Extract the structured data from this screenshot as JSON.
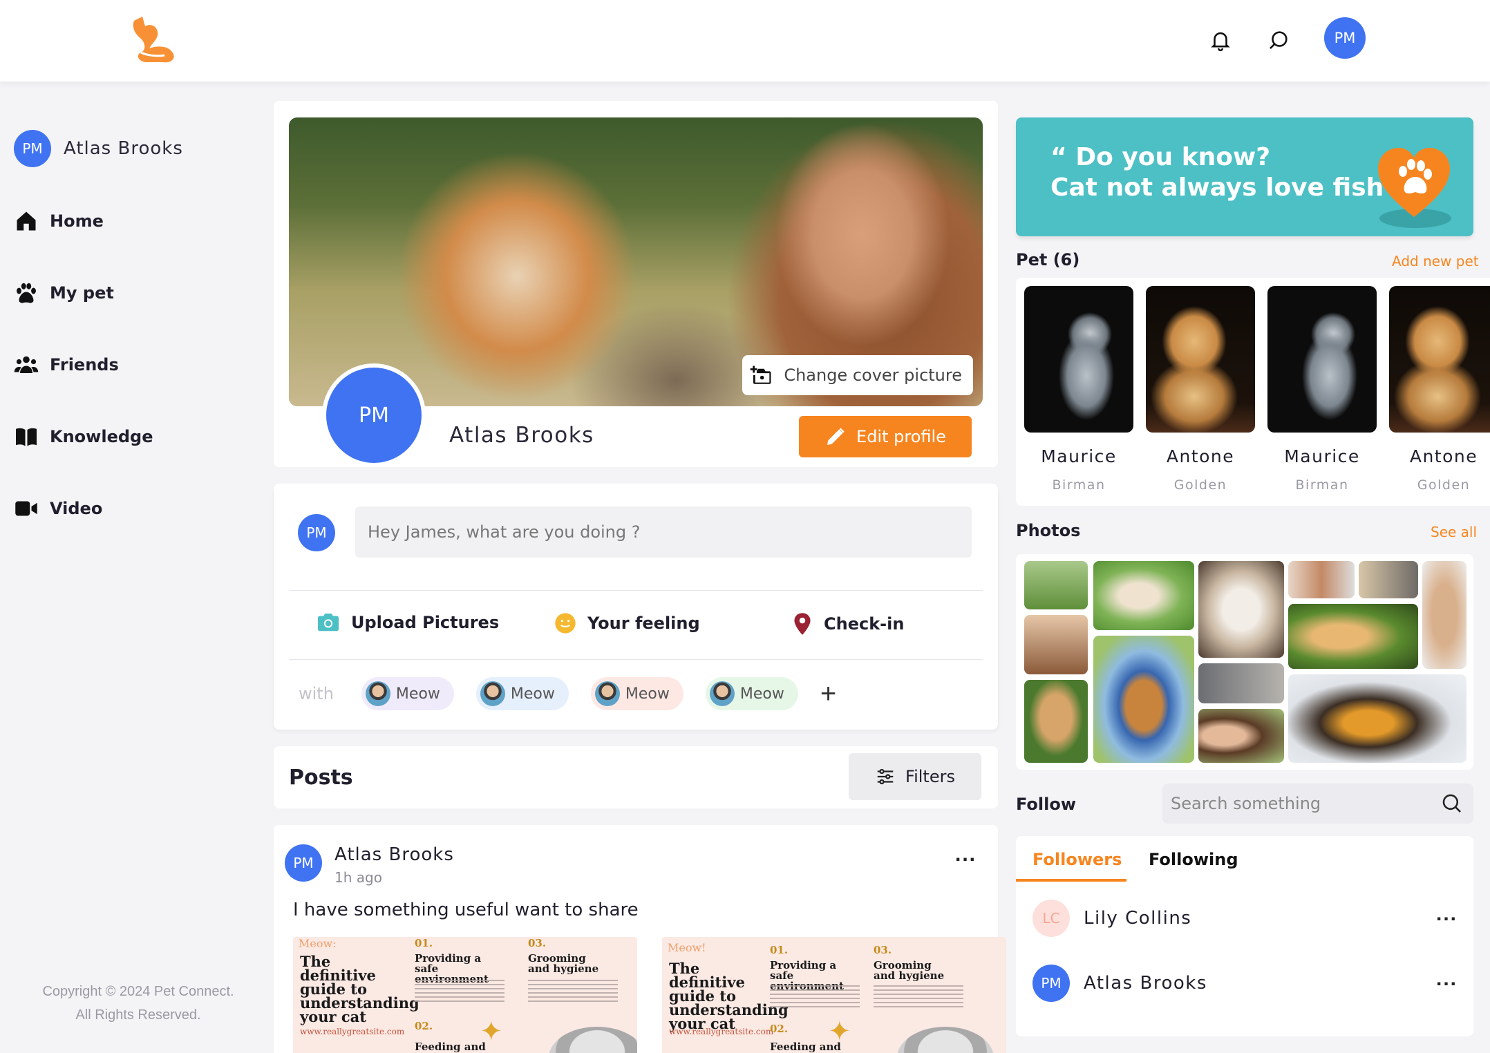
{
  "header": {
    "avatar_initials": "PM",
    "icons": [
      "bell-icon",
      "search-icon"
    ],
    "brand_color": "#f7851f",
    "accent_color": "#3f73f2"
  },
  "sidebar": {
    "user": {
      "initials": "PM",
      "name": "Atlas Brooks"
    },
    "items": [
      {
        "label": "Home",
        "icon": "home-icon"
      },
      {
        "label": "My pet",
        "icon": "paw-icon"
      },
      {
        "label": "Friends",
        "icon": "friends-icon"
      },
      {
        "label": "Knowledge",
        "icon": "book-icon"
      },
      {
        "label": "Video",
        "icon": "video-icon"
      }
    ],
    "copyright_line1": "Copyright © 2024 Pet Connect.",
    "copyright_line2": "All Rights Reserved."
  },
  "profile": {
    "change_cover_label": "Change cover picture",
    "avatar_initials": "PM",
    "name": "Atlas Brooks",
    "edit_label": "Edit profile"
  },
  "composer": {
    "avatar_initials": "PM",
    "placeholder": "Hey James, what are you doing ?",
    "actions": [
      {
        "label": "Upload Pictures",
        "icon": "camera-icon",
        "color": "#4cc0c5"
      },
      {
        "label": "Your feeling",
        "icon": "smile-icon",
        "color": "#f5b82e"
      },
      {
        "label": "Check-in",
        "icon": "location-pin-icon",
        "color": "#9b2233"
      }
    ],
    "with_label": "with",
    "tags": [
      {
        "label": "Meow",
        "bg": "#f0ebfb"
      },
      {
        "label": "Meow",
        "bg": "#e6effc"
      },
      {
        "label": "Meow",
        "bg": "#fde8e4"
      },
      {
        "label": "Meow",
        "bg": "#e6f7e8"
      }
    ],
    "add_label": "+"
  },
  "posts": {
    "title": "Posts",
    "filters_label": "Filters",
    "items": [
      {
        "avatar_initials": "PM",
        "author": "Atlas Brooks",
        "time": "1h ago",
        "more": "...",
        "text": "I have something useful want to share",
        "images": [
          {
            "brand": "Meow:",
            "title": "The definitive guide to understanding your cat",
            "url": "www.reallygreatsite.com",
            "step1_num": "01.",
            "step1": "Providing a safe environment",
            "step2_num": "02.",
            "step2": "Feeding and",
            "step3_num": "03.",
            "step3": "Grooming and hygiene"
          },
          {
            "brand": "Meow!",
            "title": "The definitive guide to understanding your cat",
            "url": "www.reallygreatsite.com",
            "step1_num": "01.",
            "step1": "Providing a safe environment",
            "step2_num": "02.",
            "step2": "Feeding and",
            "step3_num": "03.",
            "step3": "Grooming and hygiene"
          }
        ]
      }
    ]
  },
  "banner": {
    "line1": "“ Do you know?",
    "line2": "Cat not always love fish “"
  },
  "pets": {
    "title": "Pet (6)",
    "add_label": "Add new pet",
    "items": [
      {
        "name": "Maurice",
        "breed": "Birman",
        "kind": "cat"
      },
      {
        "name": "Antone",
        "breed": "Golden",
        "kind": "dog"
      },
      {
        "name": "Maurice",
        "breed": "Birman",
        "kind": "cat"
      },
      {
        "name": "Antone",
        "breed": "Golden",
        "kind": "dog"
      }
    ]
  },
  "photos": {
    "title": "Photos",
    "see_all_label": "See all"
  },
  "follow": {
    "title": "Follow",
    "search_placeholder": "Search something",
    "tabs": [
      {
        "label": "Followers",
        "active": true
      },
      {
        "label": "Following",
        "active": false
      }
    ],
    "people": [
      {
        "initials": "LC",
        "name": "Lily Collins",
        "more": "..."
      },
      {
        "initials": "PM",
        "name": "Atlas Brooks",
        "more": "..."
      }
    ]
  }
}
